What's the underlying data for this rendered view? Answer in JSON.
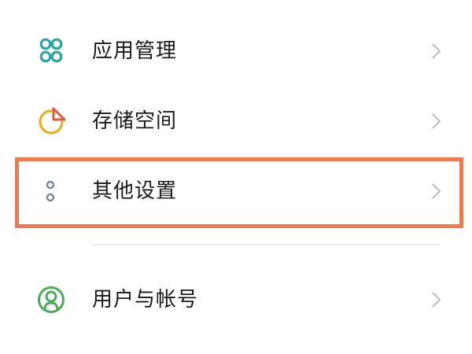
{
  "settings_list": {
    "items": [
      {
        "label": "应用管理",
        "icon": "app-management-icon",
        "color": "#2aa8a0"
      },
      {
        "label": "存储空间",
        "icon": "storage-pie-icon",
        "color": "#e9b022"
      },
      {
        "label": "其他设置",
        "icon": "other-settings-dots-icon",
        "color": "#7d8299"
      },
      {
        "label": "用户与帐号",
        "icon": "user-account-icon",
        "color": "#4caa5a"
      }
    ],
    "highlighted_item": "其他设置",
    "highlight_color": "#ee7a4d"
  }
}
